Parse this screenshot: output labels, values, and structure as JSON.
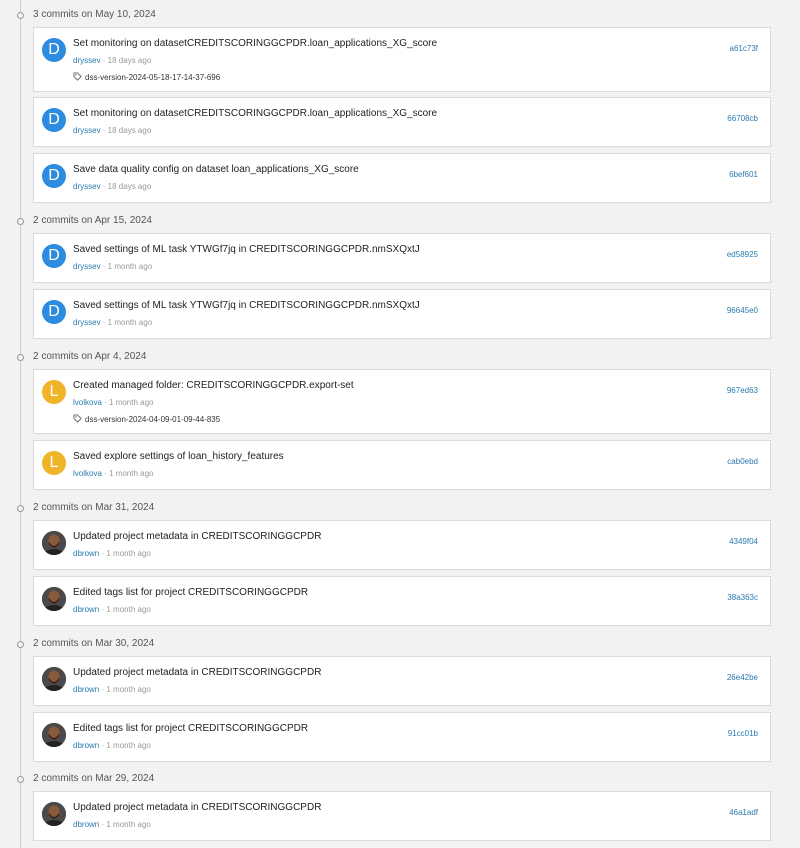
{
  "groups": [
    {
      "title": "3 commits on May 10, 2024",
      "commits": [
        {
          "message": "Set monitoring on datasetCREDITSCORINGGCPDR.loan_applications_XG_score",
          "author": "dryssev",
          "time": "18 days ago",
          "hash": "a61c73f",
          "avatar_letter": "D",
          "avatar_color": "#2d8be0",
          "tag": "dss-version-2024-05-18-17-14-37-696"
        },
        {
          "message": "Set monitoring on datasetCREDITSCORINGGCPDR.loan_applications_XG_score",
          "author": "dryssev",
          "time": "18 days ago",
          "hash": "66708cb",
          "avatar_letter": "D",
          "avatar_color": "#2d8be0"
        },
        {
          "message": "Save data quality config on dataset loan_applications_XG_score",
          "author": "dryssev",
          "time": "18 days ago",
          "hash": "6bef601",
          "avatar_letter": "D",
          "avatar_color": "#2d8be0"
        }
      ]
    },
    {
      "title": "2 commits on Apr 15, 2024",
      "commits": [
        {
          "message": "Saved settings of ML task YTWGf7jq in CREDITSCORINGGCPDR.nmSXQxtJ",
          "author": "dryssev",
          "time": "1 month ago",
          "hash": "ed58925",
          "avatar_letter": "D",
          "avatar_color": "#2d8be0"
        },
        {
          "message": "Saved settings of ML task YTWGf7jq in CREDITSCORINGGCPDR.nmSXQxtJ",
          "author": "dryssev",
          "time": "1 month ago",
          "hash": "96645e0",
          "avatar_letter": "D",
          "avatar_color": "#2d8be0"
        }
      ]
    },
    {
      "title": "2 commits on Apr 4, 2024",
      "commits": [
        {
          "message": "Created managed folder: CREDITSCORINGGCPDR.export-set",
          "author": "lvolkova",
          "time": "1 month ago",
          "hash": "967ed63",
          "avatar_letter": "L",
          "avatar_color": "#f0b429",
          "tag": "dss-version-2024-04-09-01-09-44-835"
        },
        {
          "message": "Saved explore settings of loan_history_features",
          "author": "lvolkova",
          "time": "1 month ago",
          "hash": "cab0ebd",
          "avatar_letter": "L",
          "avatar_color": "#f0b429"
        }
      ]
    },
    {
      "title": "2 commits on Mar 31, 2024",
      "commits": [
        {
          "message": "Updated project metadata in CREDITSCORINGGCPDR",
          "author": "dbrown",
          "time": "1 month ago",
          "hash": "4349f04",
          "avatar_photo": true
        },
        {
          "message": "Edited tags list for project CREDITSCORINGGCPDR",
          "author": "dbrown",
          "time": "1 month ago",
          "hash": "38a363c",
          "avatar_photo": true
        }
      ]
    },
    {
      "title": "2 commits on Mar 30, 2024",
      "commits": [
        {
          "message": "Updated project metadata in CREDITSCORINGGCPDR",
          "author": "dbrown",
          "time": "1 month ago",
          "hash": "26e42be",
          "avatar_photo": true
        },
        {
          "message": "Edited tags list for project CREDITSCORINGGCPDR",
          "author": "dbrown",
          "time": "1 month ago",
          "hash": "91cc01b",
          "avatar_photo": true
        }
      ]
    },
    {
      "title": "2 commits on Mar 29, 2024",
      "commits": [
        {
          "message": "Updated project metadata in CREDITSCORINGGCPDR",
          "author": "dbrown",
          "time": "1 month ago",
          "hash": "46a1adf",
          "avatar_photo": true
        }
      ]
    }
  ],
  "separator": " · "
}
